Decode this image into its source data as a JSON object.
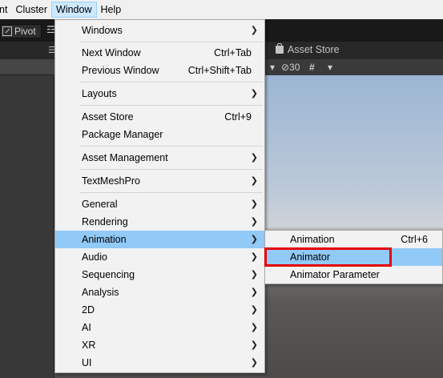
{
  "menubar": {
    "items": [
      "nt",
      "Cluster",
      "Window",
      "Help"
    ]
  },
  "toolbar": {
    "pivot_label": "Pivot",
    "glyph": "☲"
  },
  "tabs": {
    "glyph": "☰",
    "asset_store_label": "Asset Store"
  },
  "scene_toolbar": {
    "dropdown_arrow": "▾",
    "visibility_label": "⊘30",
    "gizmo_glyph": "#",
    "gizmo_arrow": "▾"
  },
  "window_menu": {
    "items": [
      {
        "label": "Windows",
        "shortcut": "",
        "submenu": true
      },
      {
        "label": "Next Window",
        "shortcut": "Ctrl+Tab",
        "submenu": false
      },
      {
        "label": "Previous Window",
        "shortcut": "Ctrl+Shift+Tab",
        "submenu": false
      },
      {
        "label": "Layouts",
        "shortcut": "",
        "submenu": true
      },
      {
        "label": "Asset Store",
        "shortcut": "Ctrl+9",
        "submenu": false
      },
      {
        "label": "Package Manager",
        "shortcut": "",
        "submenu": false
      },
      {
        "label": "Asset Management",
        "shortcut": "",
        "submenu": true
      },
      {
        "label": "TextMeshPro",
        "shortcut": "",
        "submenu": true
      },
      {
        "label": "General",
        "shortcut": "",
        "submenu": true
      },
      {
        "label": "Rendering",
        "shortcut": "",
        "submenu": true
      },
      {
        "label": "Animation",
        "shortcut": "",
        "submenu": true
      },
      {
        "label": "Audio",
        "shortcut": "",
        "submenu": true
      },
      {
        "label": "Sequencing",
        "shortcut": "",
        "submenu": true
      },
      {
        "label": "Analysis",
        "shortcut": "",
        "submenu": true
      },
      {
        "label": "2D",
        "shortcut": "",
        "submenu": true
      },
      {
        "label": "AI",
        "shortcut": "",
        "submenu": true
      },
      {
        "label": "XR",
        "shortcut": "",
        "submenu": true
      },
      {
        "label": "UI",
        "shortcut": "",
        "submenu": true
      }
    ],
    "highlighted": "Animation"
  },
  "animation_submenu": {
    "items": [
      {
        "label": "Animation",
        "shortcut": "Ctrl+6"
      },
      {
        "label": "Animator",
        "shortcut": ""
      },
      {
        "label": "Animator Parameter",
        "shortcut": ""
      }
    ],
    "highlighted": "Animator"
  },
  "colors": {
    "highlight": "#91c9f7",
    "annotation_box": "#e60000",
    "menubar_active": "#cce8ff"
  }
}
